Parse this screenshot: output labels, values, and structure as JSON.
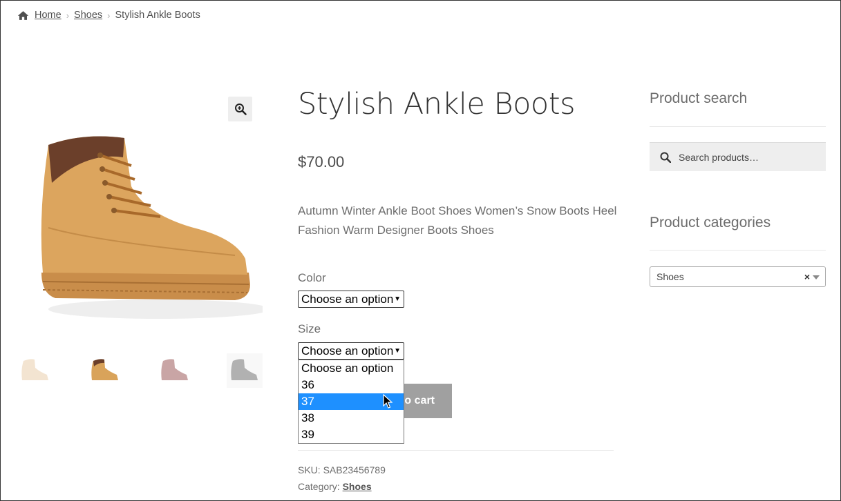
{
  "breadcrumb": {
    "home": "Home",
    "category": "Shoes",
    "current": "Stylish Ankle Boots"
  },
  "product": {
    "title": "Stylish Ankle Boots",
    "price": "$70.00",
    "description": "Autumn Winter Ankle Boot Shoes Women’s Snow Boots Heel Fashion Warm Designer Boots Shoes",
    "color_label": "Color",
    "color_select": "Choose an option",
    "size_label": "Size",
    "size_select": "Choose an option",
    "size_options": [
      "Choose an option",
      "36",
      "37",
      "38",
      "39"
    ],
    "size_highlighted": "37",
    "add_to_cart": "o cart",
    "sku_label": "SKU:",
    "sku": "SAB23456789",
    "category_label": "Category:",
    "category": "Shoes"
  },
  "gallery": {
    "thumb_count": 4
  },
  "sidebar": {
    "search_title": "Product search",
    "search_placeholder": "Search products…",
    "categories_title": "Product categories",
    "category_selected": "Shoes",
    "clear": "×"
  },
  "colors": {
    "highlight": "#1e90ff",
    "button": "#a0a0a0",
    "boot": "#d9a35a",
    "boot_collar": "#6b3f2a"
  }
}
